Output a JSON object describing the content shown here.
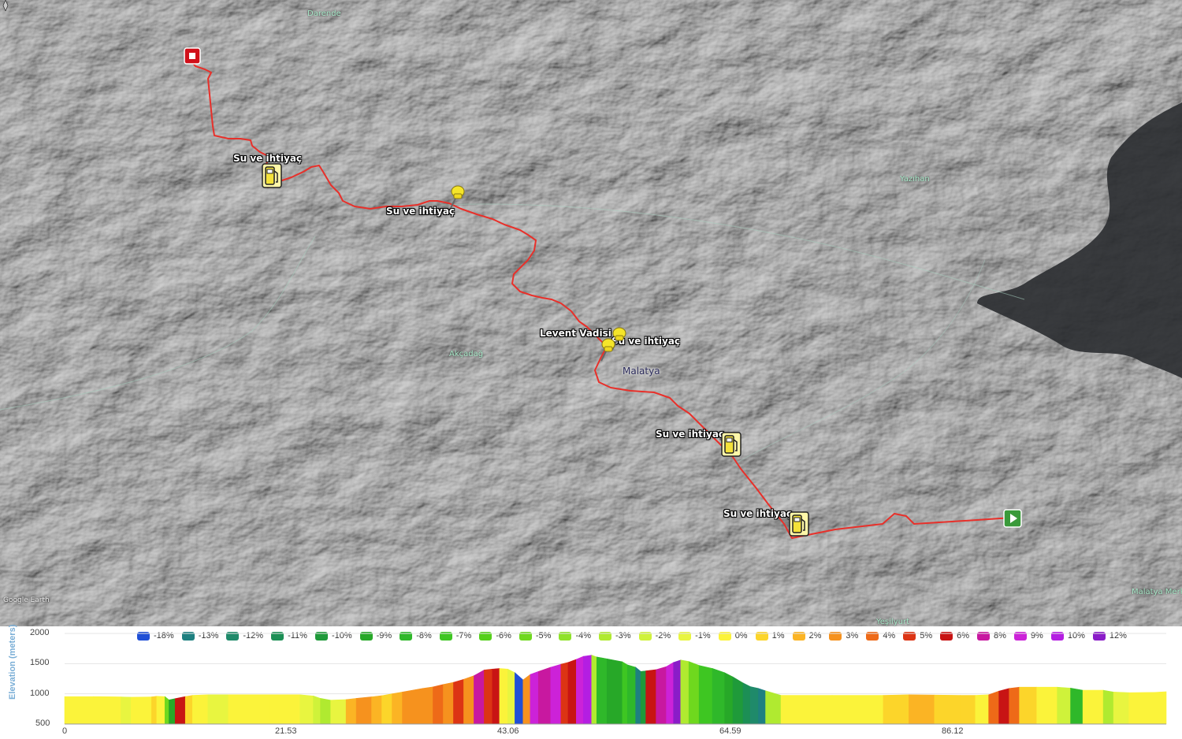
{
  "map": {
    "attribution": "Google Earth",
    "place_labels": [
      {
        "id": "darende",
        "text": "Darende"
      },
      {
        "id": "yazihan",
        "text": "Yazıhan"
      },
      {
        "id": "akcadag",
        "text": "Akçadağ"
      },
      {
        "id": "yesilyurt",
        "text": "Yeşilyurt"
      },
      {
        "id": "malatya-merkez",
        "text": "Malatya Merk"
      }
    ],
    "city_label": "Malatya",
    "poi_labels": [
      {
        "id": "su1",
        "text": "Su ve ihtiyaç",
        "icon": "fuel-pump-icon"
      },
      {
        "id": "su2",
        "text": "Su ve ihtiyaç",
        "icon": "pushpin-icon"
      },
      {
        "id": "levent",
        "text": "Levent Vadisi",
        "icon": "pushpin-icon"
      },
      {
        "id": "su3",
        "text": "Su ve ihtiyaç",
        "icon": "pushpin-icon"
      },
      {
        "id": "su4",
        "text": "Su ve ihtiyaç",
        "icon": "fuel-pump-icon"
      },
      {
        "id": "su5",
        "text": "Su ve ihtiyaç",
        "icon": "fuel-pump-icon"
      }
    ],
    "route_color": "#e8302a",
    "start_marker_color": "#3a9a3a",
    "end_marker_color": "#d0101a"
  },
  "chart_data": {
    "type": "area",
    "ylabel": "Elevation (meters)",
    "ylim": [
      500,
      2000
    ],
    "yticks": [
      "2000",
      "1500",
      "1000",
      "500"
    ],
    "xlim": [
      0,
      107.65
    ],
    "xticks": [
      "0",
      "21.53",
      "43.06",
      "64.59",
      "86.12"
    ],
    "legend": [
      {
        "label": "-18%",
        "color": "#1f4fd6"
      },
      {
        "label": "-13%",
        "color": "#1e8080"
      },
      {
        "label": "-12%",
        "color": "#1f8a6a"
      },
      {
        "label": "-11%",
        "color": "#1c8f55"
      },
      {
        "label": "-10%",
        "color": "#1f9a3a"
      },
      {
        "label": "-9%",
        "color": "#27a828"
      },
      {
        "label": "-8%",
        "color": "#2fb82a"
      },
      {
        "label": "-7%",
        "color": "#3ec622"
      },
      {
        "label": "-6%",
        "color": "#55d01a"
      },
      {
        "label": "-5%",
        "color": "#6fd81e"
      },
      {
        "label": "-4%",
        "color": "#8fe22a"
      },
      {
        "label": "-3%",
        "color": "#b0ea30"
      },
      {
        "label": "-2%",
        "color": "#cff23a"
      },
      {
        "label": "-1%",
        "color": "#e8f540"
      },
      {
        "label": "0%",
        "color": "#fbf33a"
      },
      {
        "label": "1%",
        "color": "#fcd52a"
      },
      {
        "label": "2%",
        "color": "#fbb424"
      },
      {
        "label": "3%",
        "color": "#f6921e"
      },
      {
        "label": "4%",
        "color": "#ee6a18"
      },
      {
        "label": "5%",
        "color": "#dc3414"
      },
      {
        "label": "6%",
        "color": "#c81414"
      },
      {
        "label": "8%",
        "color": "#c818a0"
      },
      {
        "label": "9%",
        "color": "#cc22d8"
      },
      {
        "label": "10%",
        "color": "#b41ee2"
      },
      {
        "label": "12%",
        "color": "#8a1cc8"
      }
    ],
    "profile": [
      [
        0,
        955,
        "0%"
      ],
      [
        2.8,
        955,
        "0%"
      ],
      [
        5.5,
        950,
        "-1%"
      ],
      [
        6.5,
        945,
        "0%"
      ],
      [
        8.5,
        950,
        "1%"
      ],
      [
        9,
        960,
        "0%"
      ],
      [
        9.8,
        955,
        "-5%"
      ],
      [
        10.2,
        900,
        "-9%"
      ],
      [
        10.8,
        920,
        "6%"
      ],
      [
        11.8,
        955,
        "1%"
      ],
      [
        12.5,
        975,
        "0%"
      ],
      [
        14,
        985,
        "-1%"
      ],
      [
        16,
        985,
        "0%"
      ],
      [
        20,
        985,
        "0%"
      ],
      [
        23,
        985,
        "-1%"
      ],
      [
        24.3,
        965,
        "-2%"
      ],
      [
        25,
        925,
        "-3%"
      ],
      [
        26,
        895,
        "-1%"
      ],
      [
        27.5,
        905,
        "2%"
      ],
      [
        28.5,
        925,
        "3%"
      ],
      [
        30,
        950,
        "2%"
      ],
      [
        31,
        970,
        "1%"
      ],
      [
        32,
        1000,
        "2%"
      ],
      [
        33,
        1030,
        "3%"
      ],
      [
        35,
        1090,
        "3%"
      ],
      [
        36,
        1115,
        "4%"
      ],
      [
        37,
        1155,
        "3%"
      ],
      [
        38,
        1190,
        "5%"
      ],
      [
        39,
        1240,
        "3%"
      ],
      [
        40,
        1300,
        "8%"
      ],
      [
        41,
        1395,
        "5%"
      ],
      [
        41.8,
        1410,
        "6%"
      ],
      [
        42.5,
        1420,
        "0%"
      ],
      [
        43.3,
        1410,
        "-1%"
      ],
      [
        44,
        1350,
        "-18%"
      ],
      [
        44.8,
        1230,
        "3%"
      ],
      [
        45.5,
        1320,
        "9%"
      ],
      [
        46.3,
        1370,
        "8%"
      ],
      [
        47.5,
        1440,
        "9%"
      ],
      [
        48.5,
        1490,
        "5%"
      ],
      [
        49.2,
        1520,
        "6%"
      ],
      [
        50,
        1570,
        "9%"
      ],
      [
        50.7,
        1620,
        "10%"
      ],
      [
        51.5,
        1640,
        "-3%"
      ],
      [
        52,
        1610,
        "-8%"
      ],
      [
        53,
        1580,
        "-9%"
      ],
      [
        54.5,
        1530,
        "-7%"
      ],
      [
        55,
        1480,
        "-8%"
      ],
      [
        55.8,
        1440,
        "-13%"
      ],
      [
        56.3,
        1370,
        "-10%"
      ],
      [
        56.8,
        1380,
        "6%"
      ],
      [
        57.8,
        1400,
        "8%"
      ],
      [
        58.8,
        1450,
        "9%"
      ],
      [
        59.5,
        1520,
        "12%"
      ],
      [
        60.2,
        1560,
        "-3%"
      ],
      [
        61,
        1535,
        "-5%"
      ],
      [
        62,
        1470,
        "-7%"
      ],
      [
        63.3,
        1420,
        "-8%"
      ],
      [
        64.5,
        1350,
        "-9%"
      ],
      [
        65.3,
        1280,
        "-10%"
      ],
      [
        66.3,
        1180,
        "-11%"
      ],
      [
        67,
        1120,
        "-12%"
      ],
      [
        67.8,
        1090,
        "-13%"
      ],
      [
        68.5,
        1050,
        "-3%"
      ],
      [
        70,
        975,
        "0%"
      ],
      [
        75,
        975,
        "0%"
      ],
      [
        80,
        975,
        "1%"
      ],
      [
        82.5,
        985,
        "2%"
      ],
      [
        85,
        980,
        "1%"
      ],
      [
        87.5,
        975,
        "1%"
      ],
      [
        89,
        975,
        "0%"
      ],
      [
        90.3,
        985,
        "4%"
      ],
      [
        91.3,
        1045,
        "6%"
      ],
      [
        92.3,
        1090,
        "4%"
      ],
      [
        93.3,
        1110,
        "1%"
      ],
      [
        95,
        1110,
        "0%"
      ],
      [
        97,
        1110,
        "-2%"
      ],
      [
        98.3,
        1095,
        "-8%"
      ],
      [
        99.5,
        1060,
        "0%"
      ],
      [
        101.5,
        1060,
        "-3%"
      ],
      [
        102.5,
        1030,
        "-1%"
      ],
      [
        104,
        1020,
        "0%"
      ],
      [
        106.5,
        1025,
        "0%"
      ],
      [
        107.65,
        1035,
        "1%"
      ]
    ]
  }
}
